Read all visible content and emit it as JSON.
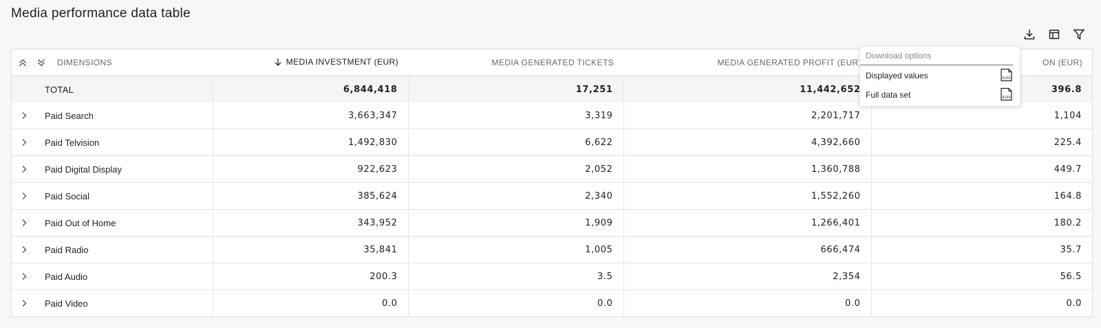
{
  "page": {
    "title": "Media performance data table"
  },
  "toolbar": {
    "download_icon": "download-icon",
    "columns_icon": "table-columns-icon",
    "filter_icon": "filter-icon"
  },
  "table": {
    "headers": {
      "dimensions": "DIMENSIONS",
      "investment": "MEDIA INVESTMENT (EUR)",
      "tickets": "MEDIA GENERATED TICKETS",
      "profit": "MEDIA GENERATED PROFIT (EUR)",
      "last": "ON (EUR)"
    },
    "total": {
      "label": "TOTAL",
      "investment": "6,844,418",
      "tickets": "17,251",
      "profit": "11,442,652",
      "last": "396.8"
    },
    "rows": [
      {
        "label": "Paid Search",
        "investment": "3,663,347",
        "tickets": "3,319",
        "profit": "2,201,717",
        "last": "1,104"
      },
      {
        "label": "Paid Telvision",
        "investment": "1,492,830",
        "tickets": "6,622",
        "profit": "4,392,660",
        "last": "225.4"
      },
      {
        "label": "Paid Digital Display",
        "investment": "922,623",
        "tickets": "2,052",
        "profit": "1,360,788",
        "last": "449.7"
      },
      {
        "label": "Paid Social",
        "investment": "385,624",
        "tickets": "2,340",
        "profit": "1,552,260",
        "last": "164.8"
      },
      {
        "label": "Paid Out of Home",
        "investment": "343,952",
        "tickets": "1,909",
        "profit": "1,266,401",
        "last": "180.2"
      },
      {
        "label": "Paid Radio",
        "investment": "35,841",
        "tickets": "1,005",
        "profit": "666,474",
        "last": "35.7"
      },
      {
        "label": "Paid Audio",
        "investment": "200.3",
        "tickets": "3.5",
        "profit": "2,354",
        "last": "56.5"
      },
      {
        "label": "Paid Video",
        "investment": "0.0",
        "tickets": "0.0",
        "profit": "0.0",
        "last": "0.0"
      }
    ]
  },
  "download_menu": {
    "title": "Download options",
    "items": [
      {
        "label": "Displayed values",
        "icon": "xlsx-file-icon",
        "icon_text": "XLSX"
      },
      {
        "label": "Full data set",
        "icon": "xlsx-file-icon",
        "icon_text": "XLSX"
      }
    ]
  }
}
